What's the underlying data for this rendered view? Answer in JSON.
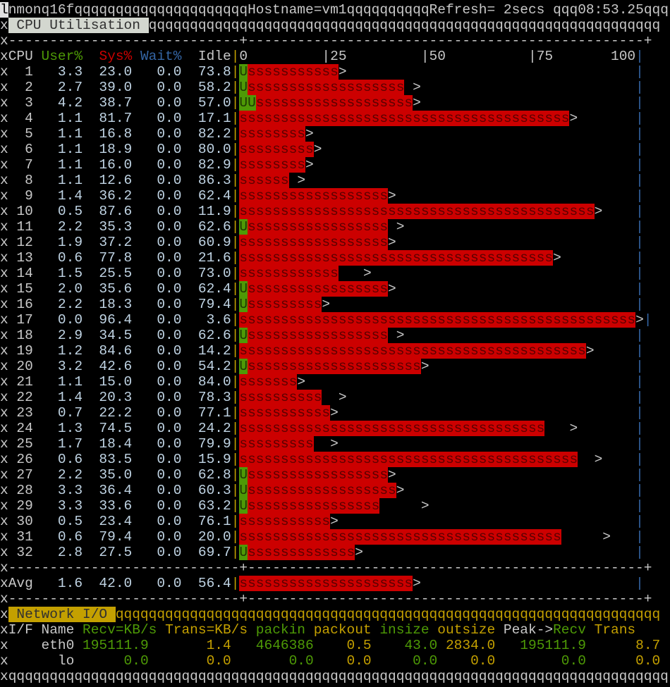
{
  "topbar": {
    "cursor": "l",
    "app": "nmon",
    "version": "16f",
    "hostname_label": "Hostname=vm1",
    "refresh_label": "Refresh= 2secs",
    "time": "08:53.25"
  },
  "cpu_panel": {
    "title": "CPU Utilisation",
    "headers": {
      "cpu": "CPU",
      "user": "User%",
      "sys": "Sys%",
      "wait": "Wait%",
      "idle": "Idle"
    },
    "scale": [
      "0",
      "|25",
      "|50",
      "|75",
      "100"
    ],
    "rows": [
      {
        "cpu": 1,
        "user": 3.3,
        "sys": 23.0,
        "wait": 0.0,
        "idle": 73.8,
        "peak": 24
      },
      {
        "cpu": 2,
        "user": 2.7,
        "sys": 39.0,
        "wait": 0.0,
        "idle": 58.2,
        "peak": 42
      },
      {
        "cpu": 3,
        "user": 4.2,
        "sys": 38.7,
        "wait": 0.0,
        "idle": 57.0,
        "peak": 42
      },
      {
        "cpu": 4,
        "user": 1.1,
        "sys": 81.7,
        "wait": 0.0,
        "idle": 17.1,
        "peak": 80
      },
      {
        "cpu": 5,
        "user": 1.1,
        "sys": 16.8,
        "wait": 0.0,
        "idle": 82.2,
        "peak": 16
      },
      {
        "cpu": 6,
        "user": 1.1,
        "sys": 18.9,
        "wait": 0.0,
        "idle": 80.0,
        "peak": 18
      },
      {
        "cpu": 7,
        "user": 1.1,
        "sys": 16.0,
        "wait": 0.0,
        "idle": 82.9,
        "peak": 16
      },
      {
        "cpu": 8,
        "user": 1.1,
        "sys": 12.6,
        "wait": 0.0,
        "idle": 86.3,
        "peak": 14
      },
      {
        "cpu": 9,
        "user": 1.4,
        "sys": 36.2,
        "wait": 0.0,
        "idle": 62.4,
        "peak": 36
      },
      {
        "cpu": 10,
        "user": 0.5,
        "sys": 87.6,
        "wait": 0.0,
        "idle": 11.9,
        "peak": 86
      },
      {
        "cpu": 11,
        "user": 2.2,
        "sys": 35.3,
        "wait": 0.0,
        "idle": 62.6,
        "peak": 38
      },
      {
        "cpu": 12,
        "user": 1.9,
        "sys": 37.2,
        "wait": 0.0,
        "idle": 60.9,
        "peak": 36
      },
      {
        "cpu": 13,
        "user": 0.6,
        "sys": 77.8,
        "wait": 0.0,
        "idle": 21.6,
        "peak": 76
      },
      {
        "cpu": 14,
        "user": 1.5,
        "sys": 25.5,
        "wait": 0.0,
        "idle": 73.0,
        "peak": 30
      },
      {
        "cpu": 15,
        "user": 2.0,
        "sys": 35.6,
        "wait": 0.0,
        "idle": 62.4,
        "peak": 36
      },
      {
        "cpu": 16,
        "user": 2.2,
        "sys": 18.3,
        "wait": 0.0,
        "idle": 79.4,
        "peak": 20
      },
      {
        "cpu": 17,
        "user": 0.0,
        "sys": 96.4,
        "wait": 0.0,
        "idle": 3.6,
        "peak": 96
      },
      {
        "cpu": 18,
        "user": 2.9,
        "sys": 34.5,
        "wait": 0.0,
        "idle": 62.6,
        "peak": 38
      },
      {
        "cpu": 19,
        "user": 1.2,
        "sys": 84.6,
        "wait": 0.0,
        "idle": 14.2,
        "peak": 84
      },
      {
        "cpu": 20,
        "user": 3.2,
        "sys": 42.6,
        "wait": 0.0,
        "idle": 54.2,
        "peak": 44
      },
      {
        "cpu": 21,
        "user": 1.1,
        "sys": 15.0,
        "wait": 0.0,
        "idle": 84.0,
        "peak": 14
      },
      {
        "cpu": 22,
        "user": 1.4,
        "sys": 20.3,
        "wait": 0.0,
        "idle": 78.3,
        "peak": 24
      },
      {
        "cpu": 23,
        "user": 0.7,
        "sys": 22.2,
        "wait": 0.0,
        "idle": 77.1,
        "peak": 22
      },
      {
        "cpu": 24,
        "user": 1.3,
        "sys": 74.5,
        "wait": 0.0,
        "idle": 24.2,
        "peak": 80
      },
      {
        "cpu": 25,
        "user": 1.7,
        "sys": 18.4,
        "wait": 0.0,
        "idle": 79.9,
        "peak": 22
      },
      {
        "cpu": 26,
        "user": 0.6,
        "sys": 83.5,
        "wait": 0.0,
        "idle": 15.9,
        "peak": 86
      },
      {
        "cpu": 27,
        "user": 2.2,
        "sys": 35.0,
        "wait": 0.0,
        "idle": 62.8,
        "peak": 36
      },
      {
        "cpu": 28,
        "user": 3.3,
        "sys": 36.4,
        "wait": 0.0,
        "idle": 60.3,
        "peak": 38
      },
      {
        "cpu": 29,
        "user": 3.3,
        "sys": 33.6,
        "wait": 0.0,
        "idle": 63.2,
        "peak": 44
      },
      {
        "cpu": 30,
        "user": 0.5,
        "sys": 23.4,
        "wait": 0.0,
        "idle": 76.1,
        "peak": 22
      },
      {
        "cpu": 31,
        "user": 0.6,
        "sys": 79.4,
        "wait": 0.0,
        "idle": 20.0,
        "peak": 88
      },
      {
        "cpu": 32,
        "user": 2.8,
        "sys": 27.5,
        "wait": 0.0,
        "idle": 69.7,
        "peak": 28
      }
    ],
    "avg": {
      "label": "Avg",
      "user": 1.6,
      "sys": 42.0,
      "wait": 0.0,
      "idle": 56.4,
      "peak": 42
    }
  },
  "network_panel": {
    "title": "Network I/O",
    "headers": [
      "I/F Name",
      "Recv=KB/s",
      "Trans=KB/s",
      "packin",
      "packout",
      "insize",
      "outsize",
      "Peak->",
      "Recv",
      "Trans"
    ],
    "rows": [
      {
        "name": "eth0",
        "values": [
          "195111.9",
          "1.4",
          "4646386",
          "0.5",
          "43.0",
          "2834.0",
          "195111.9",
          "8.7"
        ]
      },
      {
        "name": "lo",
        "values": [
          "0.0",
          "0.0",
          "0.0",
          "0.0",
          "0.0",
          "0.0",
          "0.0",
          "0.0"
        ]
      }
    ]
  },
  "colors": {
    "user": "#4e9a06",
    "sys": "#cc0000",
    "wait": "#3465a4",
    "accent": "#c4a000"
  }
}
